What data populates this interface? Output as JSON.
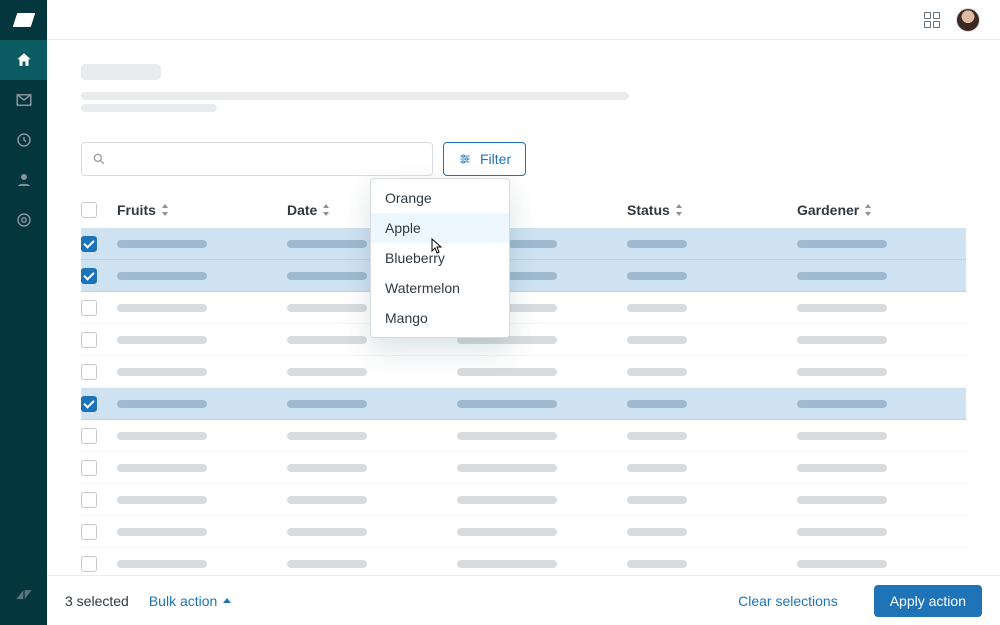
{
  "filter": {
    "label": "Filter"
  },
  "dropdown": {
    "items": [
      "Orange",
      "Apple",
      "Blueberry",
      "Watermelon",
      "Mango"
    ],
    "hover_index": 1
  },
  "columns": [
    "Fruits",
    "Date",
    "",
    "Status",
    "Gardener"
  ],
  "rows": [
    {
      "selected": true
    },
    {
      "selected": true
    },
    {
      "selected": false
    },
    {
      "selected": false
    },
    {
      "selected": false
    },
    {
      "selected": true
    },
    {
      "selected": false
    },
    {
      "selected": false
    },
    {
      "selected": false
    },
    {
      "selected": false
    },
    {
      "selected": false
    }
  ],
  "actionbar": {
    "selected_text": "3 selected",
    "bulk_action": "Bulk action",
    "clear": "Clear selections",
    "apply": "Apply action"
  }
}
